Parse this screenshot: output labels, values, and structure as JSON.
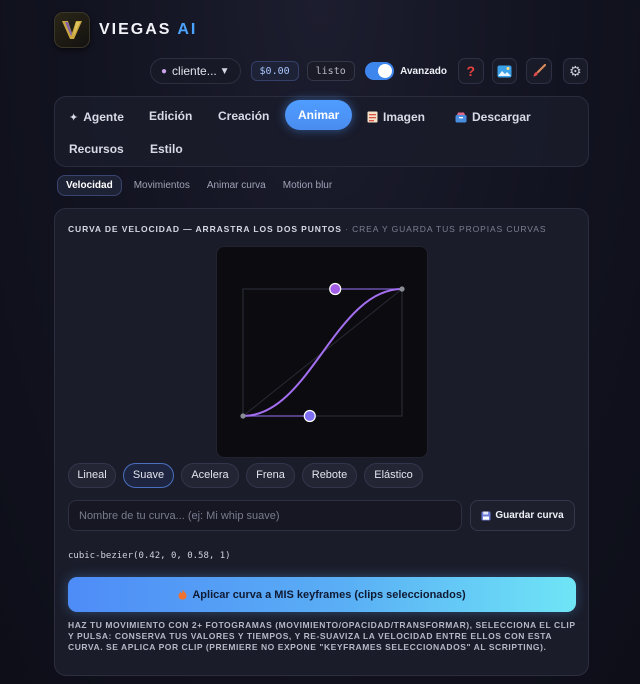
{
  "brand": {
    "name": "VIEGAS",
    "suffix": "AI",
    "accent": "#4aa3ff"
  },
  "topbar": {
    "client_select": "cliente...",
    "price": "$0.00",
    "status": "listo",
    "advanced_toggle": {
      "label": "Avanzado",
      "on": true
    }
  },
  "icons": {
    "help": "question-mark-icon",
    "media": "media-icon",
    "brush": "brush-icon",
    "settings": "gear-icon",
    "person": "person-icon",
    "save": "floppy-icon",
    "apply": "fire-icon"
  },
  "tabs": [
    {
      "label": "Agente",
      "icon": "sparkle-icon"
    },
    {
      "label": "Edición"
    },
    {
      "label": "Creación"
    },
    {
      "label": "Animar",
      "active": true
    },
    {
      "label": "Imagen",
      "icon": "image-icon"
    },
    {
      "label": "Descargar",
      "icon": "download-icon"
    },
    {
      "label": "Recursos"
    },
    {
      "label": "Estilo"
    }
  ],
  "subtabs": [
    {
      "label": "Velocidad",
      "active": true
    },
    {
      "label": "Movimientos"
    },
    {
      "label": "Animar curva"
    },
    {
      "label": "Motion blur"
    }
  ],
  "panel": {
    "title": "CURVA DE VELOCIDAD — ARRASTRA LOS DOS PUNTOS",
    "title_note": "· CREA Y GUARDA TUS PROPIAS CURVAS",
    "bezier": {
      "p1": [
        0.42,
        0
      ],
      "p2": [
        0.58,
        1
      ]
    },
    "presets": [
      {
        "label": "Lineal"
      },
      {
        "label": "Suave",
        "active": true
      },
      {
        "label": "Acelera"
      },
      {
        "label": "Frena"
      },
      {
        "label": "Rebote"
      },
      {
        "label": "Elástico"
      }
    ],
    "name_placeholder": "Nombre de tu curva... (ej: Mi whip suave)",
    "save_label": "Guardar curva",
    "code": "cubic-bezier(0.42, 0, 0.58, 1)",
    "apply_label": "Aplicar curva a MIS keyframes (clips seleccionados)",
    "help_text": "HAZ TU MOVIMIENTO CON 2+ FOTOGRAMAS (MOVIMIENTO/OPACIDAD/TRANSFORMAR), SELECCIONA EL CLIP Y PULSA: CONSERVA TUS VALORES Y TIEMPOS, Y RE-SUAVIZA LA VELOCIDAD ENTRE ELLOS CON ESTA CURVA. SE APLICA POR CLIP (PREMIERE NO EXPONE \"KEYFRAMES SELECCIONADOS\" AL SCRIPTING)."
  }
}
